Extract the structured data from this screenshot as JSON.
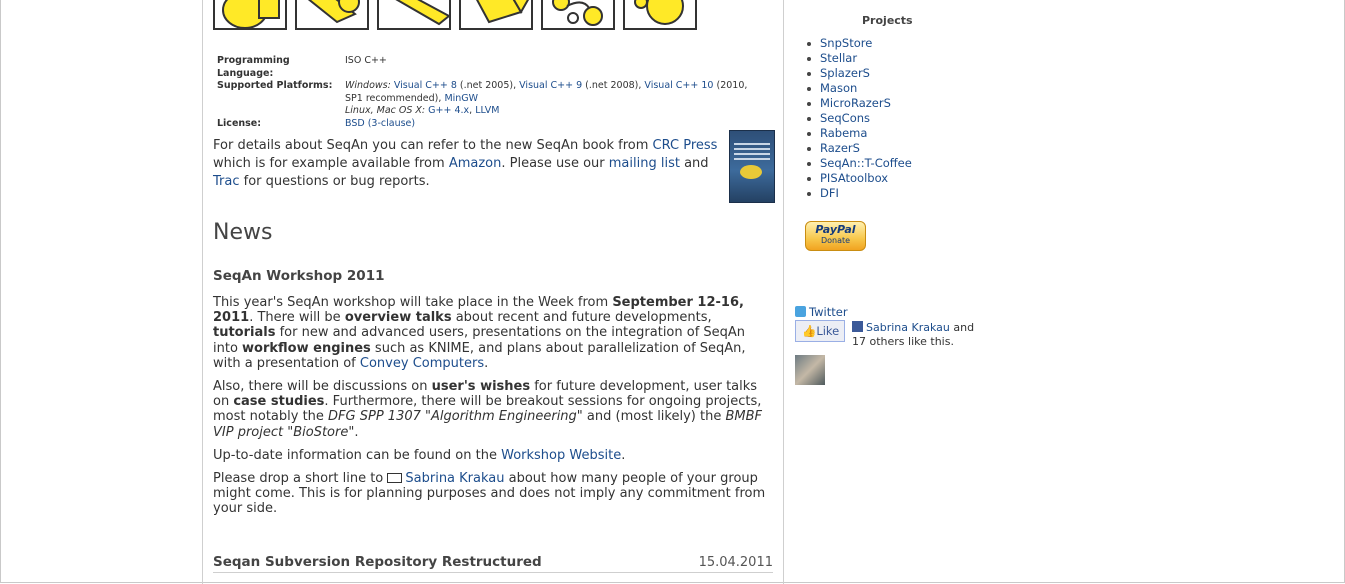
{
  "meta": {
    "lang_label": "Programming Language:",
    "lang_value": "ISO C++",
    "platforms_label": "Supported Platforms:",
    "windows_label": "Windows:",
    "vcpp8": "Visual C++ 8",
    "vcpp8_note": " (.net 2005), ",
    "vcpp9": "Visual C++ 9",
    "vcpp9_note": " (.net 2008), ",
    "vcpp10": "Visual C++ 10",
    "vcpp10_note": " (2010, SP1 recommended), ",
    "mingw": "MinGW",
    "linux_label": "Linux, Mac OS X:",
    "gpp": "G++ 4.x",
    "llvm": "LLVM",
    "license_label": "License:",
    "license_value": "BSD (3-clause)"
  },
  "intro": {
    "t1": "For details about SeqAn you can refer to the new SeqAn book from ",
    "crc": "CRC Press",
    "t2": " which is for example available from ",
    "amazon": "Amazon",
    "t3": ". Please use our ",
    "mailing": "mailing list",
    "t4": " and ",
    "trac": "Trac",
    "t5": " for questions or bug reports."
  },
  "news": {
    "heading": "News",
    "title": "SeqAn Workshop 2011",
    "p1_a": "This year's SeqAn workshop will take place in the Week from ",
    "p1_b": "September 12-16, 2011",
    "p1_c": ". There will be ",
    "p1_d": "overview talks",
    "p1_e": " about recent and future developments, ",
    "p1_f": "tutorials",
    "p1_g": " for new and advanced users, presentations on the integration of SeqAn into ",
    "p1_h": "workflow engines",
    "p1_i": " such as KNIME, and plans about parallelization of SeqAn, with a presentation of ",
    "p1_link": "Convey Computers",
    "p1_j": ".",
    "p2_a": "Also, there will be discussions on ",
    "p2_b": "user's wishes",
    "p2_c": " for future development, user talks on ",
    "p2_d": "case studies",
    "p2_e": ". Furthermore, there will be breakout sessions for ongoing projects, most notably the ",
    "p2_f": "DFG SPP 1307 \"Algorithm Engineering\"",
    "p2_g": " and (most likely) the ",
    "p2_h": "BMBF VIP project \"BioStore\"",
    "p2_i": ".",
    "p3_a": "Up-to-date information can be found on the ",
    "p3_link": "Workshop Website",
    "p3_b": ".",
    "p4_a": "Please drop a short line to ",
    "p4_link": "Sabrina Krakau",
    "p4_b": " about how many people of your group might come. This is for planning purposes and does not imply any commitment from your side.",
    "second_title": "Seqan Subversion Repository Restructured",
    "second_date": "15.04.2011"
  },
  "sidebar": {
    "title": "Projects",
    "projects": [
      "SnpStore",
      "Stellar",
      "SplazerS",
      "Mason",
      "MicroRazerS",
      "SeqCons",
      "Rabema",
      "RazerS",
      "SeqAn::T-Coffee",
      "PISAtoolbox",
      "DFI"
    ],
    "paypal_label": "PayPal",
    "donate_label": "Donate",
    "twitter_label": "Twitter",
    "like_label": "Like",
    "fb_name": "Sabrina Krakau",
    "fb_and": " and",
    "fb_others": "17 others like this."
  }
}
